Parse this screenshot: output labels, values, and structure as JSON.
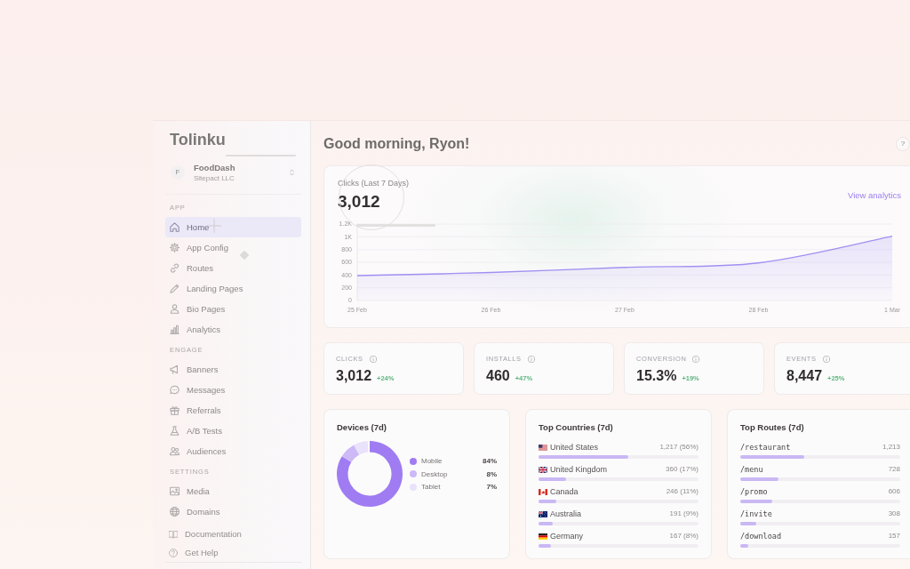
{
  "sidebar": {
    "logo": "Tolinku",
    "workspace": {
      "initial": "F",
      "name": "FoodDash",
      "company": "Sitepact LLC"
    },
    "sections": [
      {
        "heading": "APP",
        "items": [
          {
            "label": "Home",
            "selected": true
          },
          {
            "label": "App Config",
            "selected": false
          },
          {
            "label": "Routes",
            "selected": false
          },
          {
            "label": "Landing Pages",
            "selected": false
          },
          {
            "label": "Bio Pages",
            "selected": false
          },
          {
            "label": "Analytics",
            "selected": false
          }
        ]
      },
      {
        "heading": "ENGAGE",
        "items": [
          {
            "label": "Banners",
            "selected": false
          },
          {
            "label": "Messages",
            "selected": false
          },
          {
            "label": "Referrals",
            "selected": false
          },
          {
            "label": "A/B Tests",
            "selected": false
          },
          {
            "label": "Audiences",
            "selected": false
          }
        ]
      },
      {
        "heading": "SETTINGS",
        "items": [
          {
            "label": "Media",
            "selected": false
          },
          {
            "label": "Domains",
            "selected": false
          }
        ]
      }
    ],
    "footer_links": [
      "Documentation",
      "Get Help"
    ]
  },
  "header": {
    "greeting": "Good morning, Ryon!",
    "help": "?"
  },
  "clicks_card": {
    "title": "Clicks (Last 7 Days)",
    "total": "3,012",
    "link": "View analytics",
    "chart_data": {
      "type": "area",
      "categories": [
        "25 Feb",
        "26 Feb",
        "27 Feb",
        "28 Feb",
        "1 Mar"
      ],
      "series": [
        {
          "color": "#a290f2",
          "values": [
            390,
            440,
            520,
            590,
            1010
          ]
        }
      ],
      "ylim": [
        0,
        1200
      ],
      "yticks": [
        0,
        200,
        400,
        600,
        800,
        {
          "value": 1000,
          "label": "1K"
        },
        {
          "value": 1200,
          "label": "1.2K"
        }
      ],
      "grid": true
    }
  },
  "stats": [
    {
      "label": "CLICKS",
      "value": "3,012",
      "change": "+24%"
    },
    {
      "label": "INSTALLS",
      "value": "460",
      "change": "+47%"
    },
    {
      "label": "CONVERSION",
      "value": "15.3%",
      "change": "+19%"
    },
    {
      "label": "EVENTS",
      "value": "8,447",
      "change": "+25%"
    }
  ],
  "devices": {
    "title": "Devices (7d)",
    "chart_data": {
      "type": "donut",
      "categories": [
        "Mobile",
        "Desktop",
        "Tablet"
      ],
      "values": [
        84,
        8,
        7
      ]
    },
    "legend": [
      {
        "share": "84%",
        "color": "#a07cf2"
      },
      {
        "share": "8%",
        "color": "#cdb9f6"
      },
      {
        "share": "7%",
        "color": "#e9e2fa"
      }
    ]
  },
  "top_countries": {
    "title": "Top Countries (7d)",
    "rows": [
      {
        "name": "United States",
        "reading": "1,217 (56%)",
        "level": 0.56
      },
      {
        "name": "United Kingdom",
        "reading": "360 (17%)",
        "level": 0.17
      },
      {
        "name": "Canada",
        "reading": "246 (11%)",
        "level": 0.11
      },
      {
        "name": "Australia",
        "reading": "191 (9%)",
        "level": 0.09
      },
      {
        "name": "Germany",
        "reading": "167 (8%)",
        "level": 0.08
      }
    ]
  },
  "top_routes": {
    "title": "Top Routes (7d)",
    "rows": [
      {
        "path": "/restaurant",
        "reading": "1,213",
        "level": 0.4
      },
      {
        "path": "/menu",
        "reading": "728",
        "level": 0.24
      },
      {
        "path": "/promo",
        "reading": "606",
        "level": 0.2
      },
      {
        "path": "/invite",
        "reading": "308",
        "level": 0.1
      },
      {
        "path": "/download",
        "reading": "157",
        "level": 0.05
      }
    ]
  }
}
